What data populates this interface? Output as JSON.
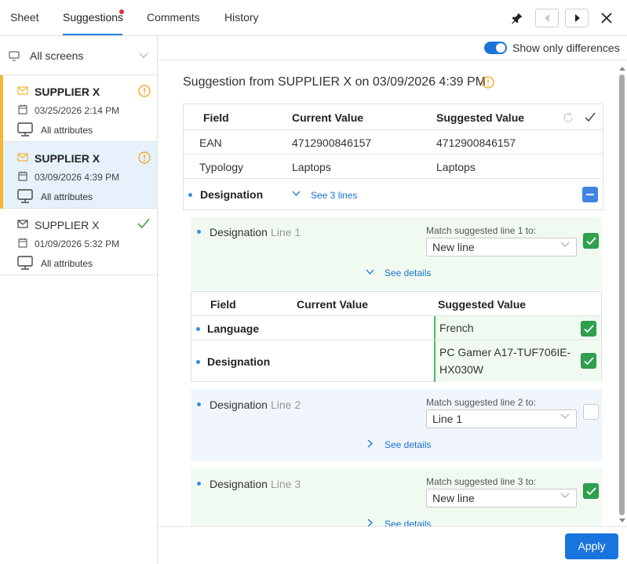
{
  "tabs": [
    "Sheet",
    "Suggestions",
    "Comments",
    "History"
  ],
  "sidebar": {
    "screens_label": "All screens",
    "cards": [
      {
        "title": "SUPPLIER X",
        "date": "03/25/2026 2:14 PM",
        "attrs": "All attributes",
        "status": "warning"
      },
      {
        "title": "SUPPLIER X",
        "date": "03/09/2026 4:39 PM",
        "attrs": "All attributes",
        "status": "warning"
      },
      {
        "title": "SUPPLIER X",
        "date": "01/09/2026 5:32 PM",
        "attrs": "All attributes",
        "status": "done"
      }
    ]
  },
  "toggle_label": "Show only differences",
  "heading": "Suggestion from SUPPLIER X on 03/09/2026 4:39 PM",
  "table": {
    "headers": [
      "Field",
      "Current Value",
      "Suggested Value"
    ],
    "rows": [
      {
        "field": "EAN",
        "current": "4712900846157",
        "suggested": "4712900846157"
      },
      {
        "field": "Typology",
        "current": "Laptops",
        "suggested": "Laptops"
      }
    ],
    "group": {
      "field": "Designation",
      "link": "See 3 lines"
    }
  },
  "lines": [
    {
      "field": "Designation",
      "line": "Line 1",
      "match_label": "Match suggested line 1 to:",
      "select": "New line",
      "details": "See details"
    },
    {
      "field": "Designation",
      "line": "Line 2",
      "match_label": "Match suggested line 2 to:",
      "select": "Line 1",
      "details": "See details"
    },
    {
      "field": "Designation",
      "line": "Line 3",
      "match_label": "Match suggested line 3 to:",
      "select": "New line",
      "details": "See details"
    }
  ],
  "sub_table": {
    "headers": [
      "Field",
      "Current Value",
      "Suggested Value"
    ],
    "rows": [
      {
        "field": "Language",
        "current": "",
        "suggested": "French"
      },
      {
        "field": "Designation",
        "current": "",
        "suggested_1": "PC Gamer A17-TUF706IE-",
        "suggested_2": "HX030W"
      }
    ]
  },
  "apply_label": "Apply",
  "colors": {
    "accent": "#1a74dd",
    "warning": "#f5b731",
    "success": "#2ea04e",
    "panel_green": "#f1faf1"
  }
}
